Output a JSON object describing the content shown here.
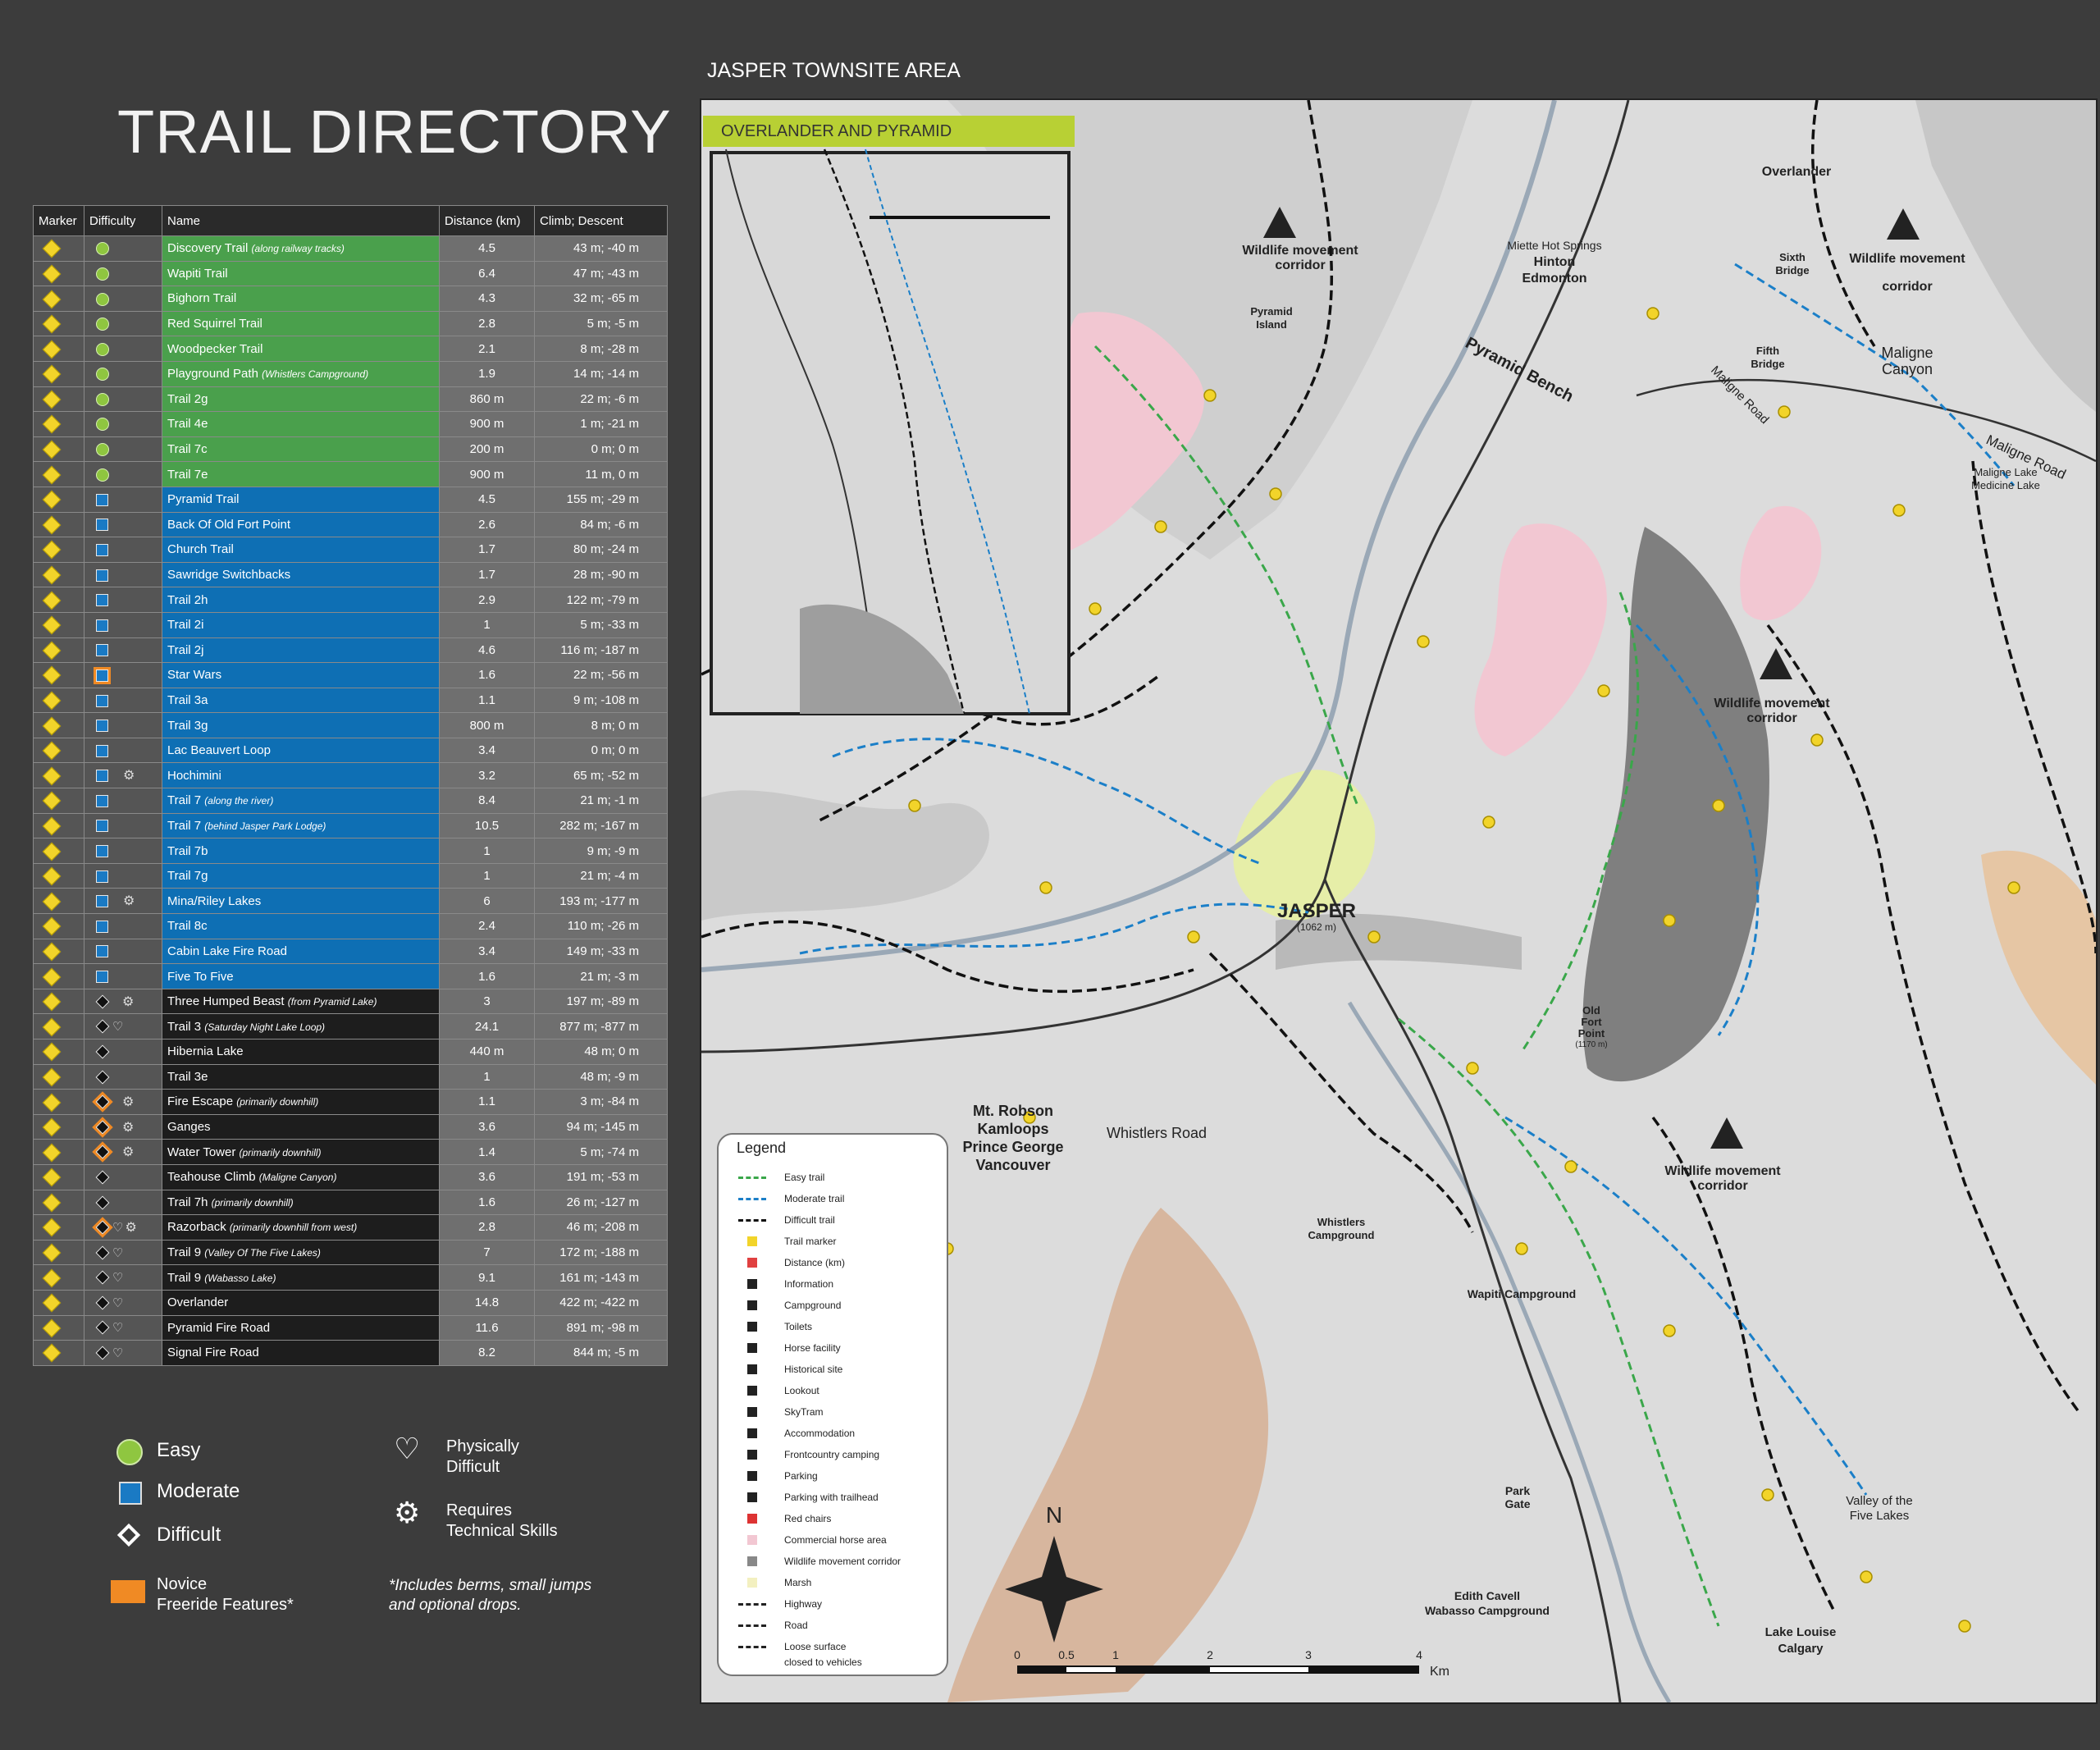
{
  "title": "TRAIL DIRECTORY",
  "columns": [
    "Marker",
    "Difficulty",
    "Name",
    "Distance (km)",
    "Climb; Descent"
  ],
  "trails": [
    {
      "level": "easy",
      "name": "Discovery Trail",
      "note": "(along railway tracks)",
      "dist": "4.5",
      "climb": "43 m; -40 m",
      "novice": false,
      "phys": false,
      "tech": false
    },
    {
      "level": "easy",
      "name": "Wapiti Trail",
      "note": "",
      "dist": "6.4",
      "climb": "47 m; -43 m",
      "novice": false,
      "phys": false,
      "tech": false
    },
    {
      "level": "easy",
      "name": "Bighorn Trail",
      "note": "",
      "dist": "4.3",
      "climb": "32 m; -65 m",
      "novice": false,
      "phys": false,
      "tech": false
    },
    {
      "level": "easy",
      "name": "Red Squirrel Trail",
      "note": "",
      "dist": "2.8",
      "climb": "5 m; -5 m",
      "novice": false,
      "phys": false,
      "tech": false
    },
    {
      "level": "easy",
      "name": "Woodpecker Trail",
      "note": "",
      "dist": "2.1",
      "climb": "8 m; -28 m",
      "novice": false,
      "phys": false,
      "tech": false
    },
    {
      "level": "easy",
      "name": "Playground Path",
      "note": "(Whistlers Campground)",
      "dist": "1.9",
      "climb": "14 m; -14 m",
      "novice": false,
      "phys": false,
      "tech": false
    },
    {
      "level": "easy",
      "name": "Trail 2g",
      "note": "",
      "dist": "860 m",
      "climb": "22 m; -6 m",
      "novice": false,
      "phys": false,
      "tech": false
    },
    {
      "level": "easy",
      "name": "Trail 4e",
      "note": "",
      "dist": "900 m",
      "climb": "1 m; -21 m",
      "novice": false,
      "phys": false,
      "tech": false
    },
    {
      "level": "easy",
      "name": "Trail 7c",
      "note": "",
      "dist": "200 m",
      "climb": "0 m; 0 m",
      "novice": false,
      "phys": false,
      "tech": false
    },
    {
      "level": "easy",
      "name": "Trail 7e",
      "note": "",
      "dist": "900 m",
      "climb": "11 m, 0 m",
      "novice": false,
      "phys": false,
      "tech": false
    },
    {
      "level": "moderate",
      "name": "Pyramid Trail",
      "note": "",
      "dist": "4.5",
      "climb": "155 m; -29 m",
      "novice": false,
      "phys": false,
      "tech": false
    },
    {
      "level": "moderate",
      "name": "Back Of Old Fort Point",
      "note": "",
      "dist": "2.6",
      "climb": "84 m; -6 m",
      "novice": false,
      "phys": false,
      "tech": false
    },
    {
      "level": "moderate",
      "name": "Church Trail",
      "note": "",
      "dist": "1.7",
      "climb": "80 m; -24 m",
      "novice": false,
      "phys": false,
      "tech": false
    },
    {
      "level": "moderate",
      "name": "Sawridge Switchbacks",
      "note": "",
      "dist": "1.7",
      "climb": "28 m; -90 m",
      "novice": false,
      "phys": false,
      "tech": false
    },
    {
      "level": "moderate",
      "name": "Trail 2h",
      "note": "",
      "dist": "2.9",
      "climb": "122 m; -79 m",
      "novice": false,
      "phys": false,
      "tech": false
    },
    {
      "level": "moderate",
      "name": "Trail 2i",
      "note": "",
      "dist": "1",
      "climb": "5 m; -33 m",
      "novice": false,
      "phys": false,
      "tech": false
    },
    {
      "level": "moderate",
      "name": "Trail 2j",
      "note": "",
      "dist": "4.6",
      "climb": "116 m; -187 m",
      "novice": false,
      "phys": false,
      "tech": false
    },
    {
      "level": "moderate",
      "name": "Star Wars",
      "note": "",
      "dist": "1.6",
      "climb": "22 m; -56 m",
      "novice": true,
      "phys": false,
      "tech": false
    },
    {
      "level": "moderate",
      "name": "Trail 3a",
      "note": "",
      "dist": "1.1",
      "climb": "9 m; -108 m",
      "novice": false,
      "phys": false,
      "tech": false
    },
    {
      "level": "moderate",
      "name": "Trail 3g",
      "note": "",
      "dist": "800 m",
      "climb": "8 m; 0 m",
      "novice": false,
      "phys": false,
      "tech": false
    },
    {
      "level": "moderate",
      "name": "Lac Beauvert Loop",
      "note": "",
      "dist": "3.4",
      "climb": "0 m; 0 m",
      "novice": false,
      "phys": false,
      "tech": false
    },
    {
      "level": "moderate",
      "name": "Hochimini",
      "note": "",
      "dist": "3.2",
      "climb": "65 m; -52 m",
      "novice": false,
      "phys": false,
      "tech": true
    },
    {
      "level": "moderate",
      "name": "Trail 7",
      "note": "(along the river)",
      "dist": "8.4",
      "climb": "21 m; -1 m",
      "novice": false,
      "phys": false,
      "tech": false
    },
    {
      "level": "moderate",
      "name": "Trail 7",
      "note": "(behind Jasper Park Lodge)",
      "dist": "10.5",
      "climb": "282 m; -167 m",
      "novice": false,
      "phys": false,
      "tech": false
    },
    {
      "level": "moderate",
      "name": "Trail 7b",
      "note": "",
      "dist": "1",
      "climb": "9 m; -9 m",
      "novice": false,
      "phys": false,
      "tech": false
    },
    {
      "level": "moderate",
      "name": "Trail 7g",
      "note": "",
      "dist": "1",
      "climb": "21 m; -4 m",
      "novice": false,
      "phys": false,
      "tech": false
    },
    {
      "level": "moderate",
      "name": "Mina/Riley Lakes",
      "note": "",
      "dist": "6",
      "climb": "193 m; -177 m",
      "novice": false,
      "phys": false,
      "tech": true
    },
    {
      "level": "moderate",
      "name": "Trail 8c",
      "note": "",
      "dist": "2.4",
      "climb": "110 m; -26 m",
      "novice": false,
      "phys": false,
      "tech": false
    },
    {
      "level": "moderate",
      "name": "Cabin Lake Fire Road",
      "note": "",
      "dist": "3.4",
      "climb": "149 m; -33 m",
      "novice": false,
      "phys": false,
      "tech": false
    },
    {
      "level": "moderate",
      "name": "Five To Five",
      "note": "",
      "dist": "1.6",
      "climb": "21 m; -3 m",
      "novice": false,
      "phys": false,
      "tech": false
    },
    {
      "level": "difficult",
      "name": "Three Humped Beast",
      "note": "(from Pyramid Lake)",
      "dist": "3",
      "climb": "197 m; -89 m",
      "novice": false,
      "phys": false,
      "tech": true
    },
    {
      "level": "difficult",
      "name": "Trail 3",
      "note": "(Saturday Night Lake Loop)",
      "dist": "24.1",
      "climb": "877 m; -877 m",
      "novice": false,
      "phys": true,
      "tech": false
    },
    {
      "level": "difficult",
      "name": "Hibernia Lake",
      "note": "",
      "dist": "440 m",
      "climb": "48 m; 0 m",
      "novice": false,
      "phys": false,
      "tech": false
    },
    {
      "level": "difficult",
      "name": "Trail 3e",
      "note": "",
      "dist": "1",
      "climb": "48 m; -9 m",
      "novice": false,
      "phys": false,
      "tech": false
    },
    {
      "level": "difficult",
      "name": "Fire Escape",
      "note": "(primarily downhill)",
      "dist": "1.1",
      "climb": "3 m; -84 m",
      "novice": true,
      "phys": false,
      "tech": true
    },
    {
      "level": "difficult",
      "name": "Ganges",
      "note": "",
      "dist": "3.6",
      "climb": "94 m; -145 m",
      "novice": true,
      "phys": false,
      "tech": true
    },
    {
      "level": "difficult",
      "name": "Water Tower",
      "note": "(primarily downhill)",
      "dist": "1.4",
      "climb": "5 m; -74 m",
      "novice": true,
      "phys": false,
      "tech": true
    },
    {
      "level": "difficult",
      "name": "Teahouse Climb",
      "note": "(Maligne Canyon)",
      "dist": "3.6",
      "climb": "191 m; -53 m",
      "novice": false,
      "phys": false,
      "tech": false
    },
    {
      "level": "difficult",
      "name": "Trail 7h",
      "note": "(primarily downhill)",
      "dist": "1.6",
      "climb": "26 m; -127 m",
      "novice": false,
      "phys": false,
      "tech": false
    },
    {
      "level": "difficult",
      "name": "Razorback",
      "note": "(primarily downhill from west)",
      "dist": "2.8",
      "climb": "46 m; -208 m",
      "novice": true,
      "phys": true,
      "tech": true
    },
    {
      "level": "difficult",
      "name": "Trail 9",
      "note": "(Valley Of The Five Lakes)",
      "dist": "7",
      "climb": "172 m; -188 m",
      "novice": false,
      "phys": true,
      "tech": false
    },
    {
      "level": "difficult",
      "name": "Trail 9",
      "note": "(Wabasso Lake)",
      "dist": "9.1",
      "climb": "161 m; -143 m",
      "novice": false,
      "phys": true,
      "tech": false
    },
    {
      "level": "difficult",
      "name": "Overlander",
      "note": "",
      "dist": "14.8",
      "climb": "422 m; -422 m",
      "novice": false,
      "phys": true,
      "tech": false
    },
    {
      "level": "difficult",
      "name": "Pyramid Fire Road",
      "note": "",
      "dist": "11.6",
      "climb": "891 m; -98 m",
      "novice": false,
      "phys": true,
      "tech": false
    },
    {
      "level": "difficult",
      "name": "Signal Fire Road",
      "note": "",
      "dist": "8.2",
      "climb": "844 m; -5 m",
      "novice": false,
      "phys": true,
      "tech": false
    }
  ],
  "legend": {
    "easy": "Easy",
    "moderate": "Moderate",
    "difficult": "Difficult",
    "novice_1": "Novice",
    "novice_2": "Freeride Features*",
    "phys_1": "Physically",
    "phys_2": "Difficult",
    "tech_1": "Requires",
    "tech_2": "Technical Skills",
    "note_1": "*Includes berms, small jumps",
    "note_2": "and optional drops."
  },
  "colors": {
    "easy": "#4aa04c",
    "moderate": "#0e6fb4",
    "difficult": "#1d1d1d",
    "novice": "#f08a24",
    "marker": "#f2d42a",
    "horse_area": "#f2c7d2"
  },
  "map": {
    "title": "JASPER TOWNSITE AREA",
    "inset_title": "OVERLANDER AND PYRAMID",
    "town": "JASPER",
    "town_elev": "(1062 m)",
    "labels": {
      "wildlife": "Wildlife movement",
      "corridor": "corridor",
      "overlander": "Overlander",
      "sixth_1": "Sixth",
      "sixth_2": "Bridge",
      "fifth_1": "Fifth",
      "fifth_2": "Bridge",
      "miette": "Miette Hot Springs",
      "hinton": "Hinton",
      "edmonton": "Edmonton",
      "pyramid_bench": "Pyramid Bench",
      "pyramid_island_1": "Pyramid",
      "pyramid_island_2": "Island",
      "maligne_canyon_1": "Maligne",
      "maligne_canyon_2": "Canyon",
      "maligne_road": "Maligne Road",
      "maligne_lake_1": "Maligne Lake",
      "maligne_lake_2": "Medicine Lake",
      "old_fort_1": "Old",
      "old_fort_2": "Fort",
      "old_fort_3": "Point",
      "old_fort_4": "(1170 m)",
      "robson": "Mt. Robson",
      "kamloops": "Kamloops",
      "pg": "Prince George",
      "vancouver": "Vancouver",
      "whistlers_road": "Whistlers Road",
      "whistlers_camp_1": "Whistlers",
      "whistlers_camp_2": "Campground",
      "wapiti_camp": "Wapiti Campground",
      "park_1": "Park",
      "park_2": "Gate",
      "valley_1": "Valley of the",
      "valley_2": "Five Lakes",
      "edith_1": "Edith Cavell",
      "edith_2": "Wabasso Campground",
      "lake_louise": "Lake Louise",
      "calgary": "Calgary",
      "north": "N"
    },
    "scale": {
      "ticks": [
        "0",
        "0.5",
        "1",
        "2",
        "3",
        "4"
      ],
      "unit": "Km"
    },
    "legend_title": "Legend",
    "legend_items": [
      "Easy trail",
      "Moderate trail",
      "Difficult trail",
      "Trail marker",
      "Distance (km)",
      "Information",
      "Campground",
      "Toilets",
      "Horse facility",
      "Historical site",
      "Lookout",
      "SkyTram",
      "Accommodation",
      "Frontcountry camping",
      "Parking",
      "Parking with trailhead",
      "Red chairs",
      "Commercial horse area",
      "Wildlife movement corridor",
      "Marsh",
      "Highway",
      "Road",
      "Loose surface",
      "closed to vehicles"
    ]
  }
}
